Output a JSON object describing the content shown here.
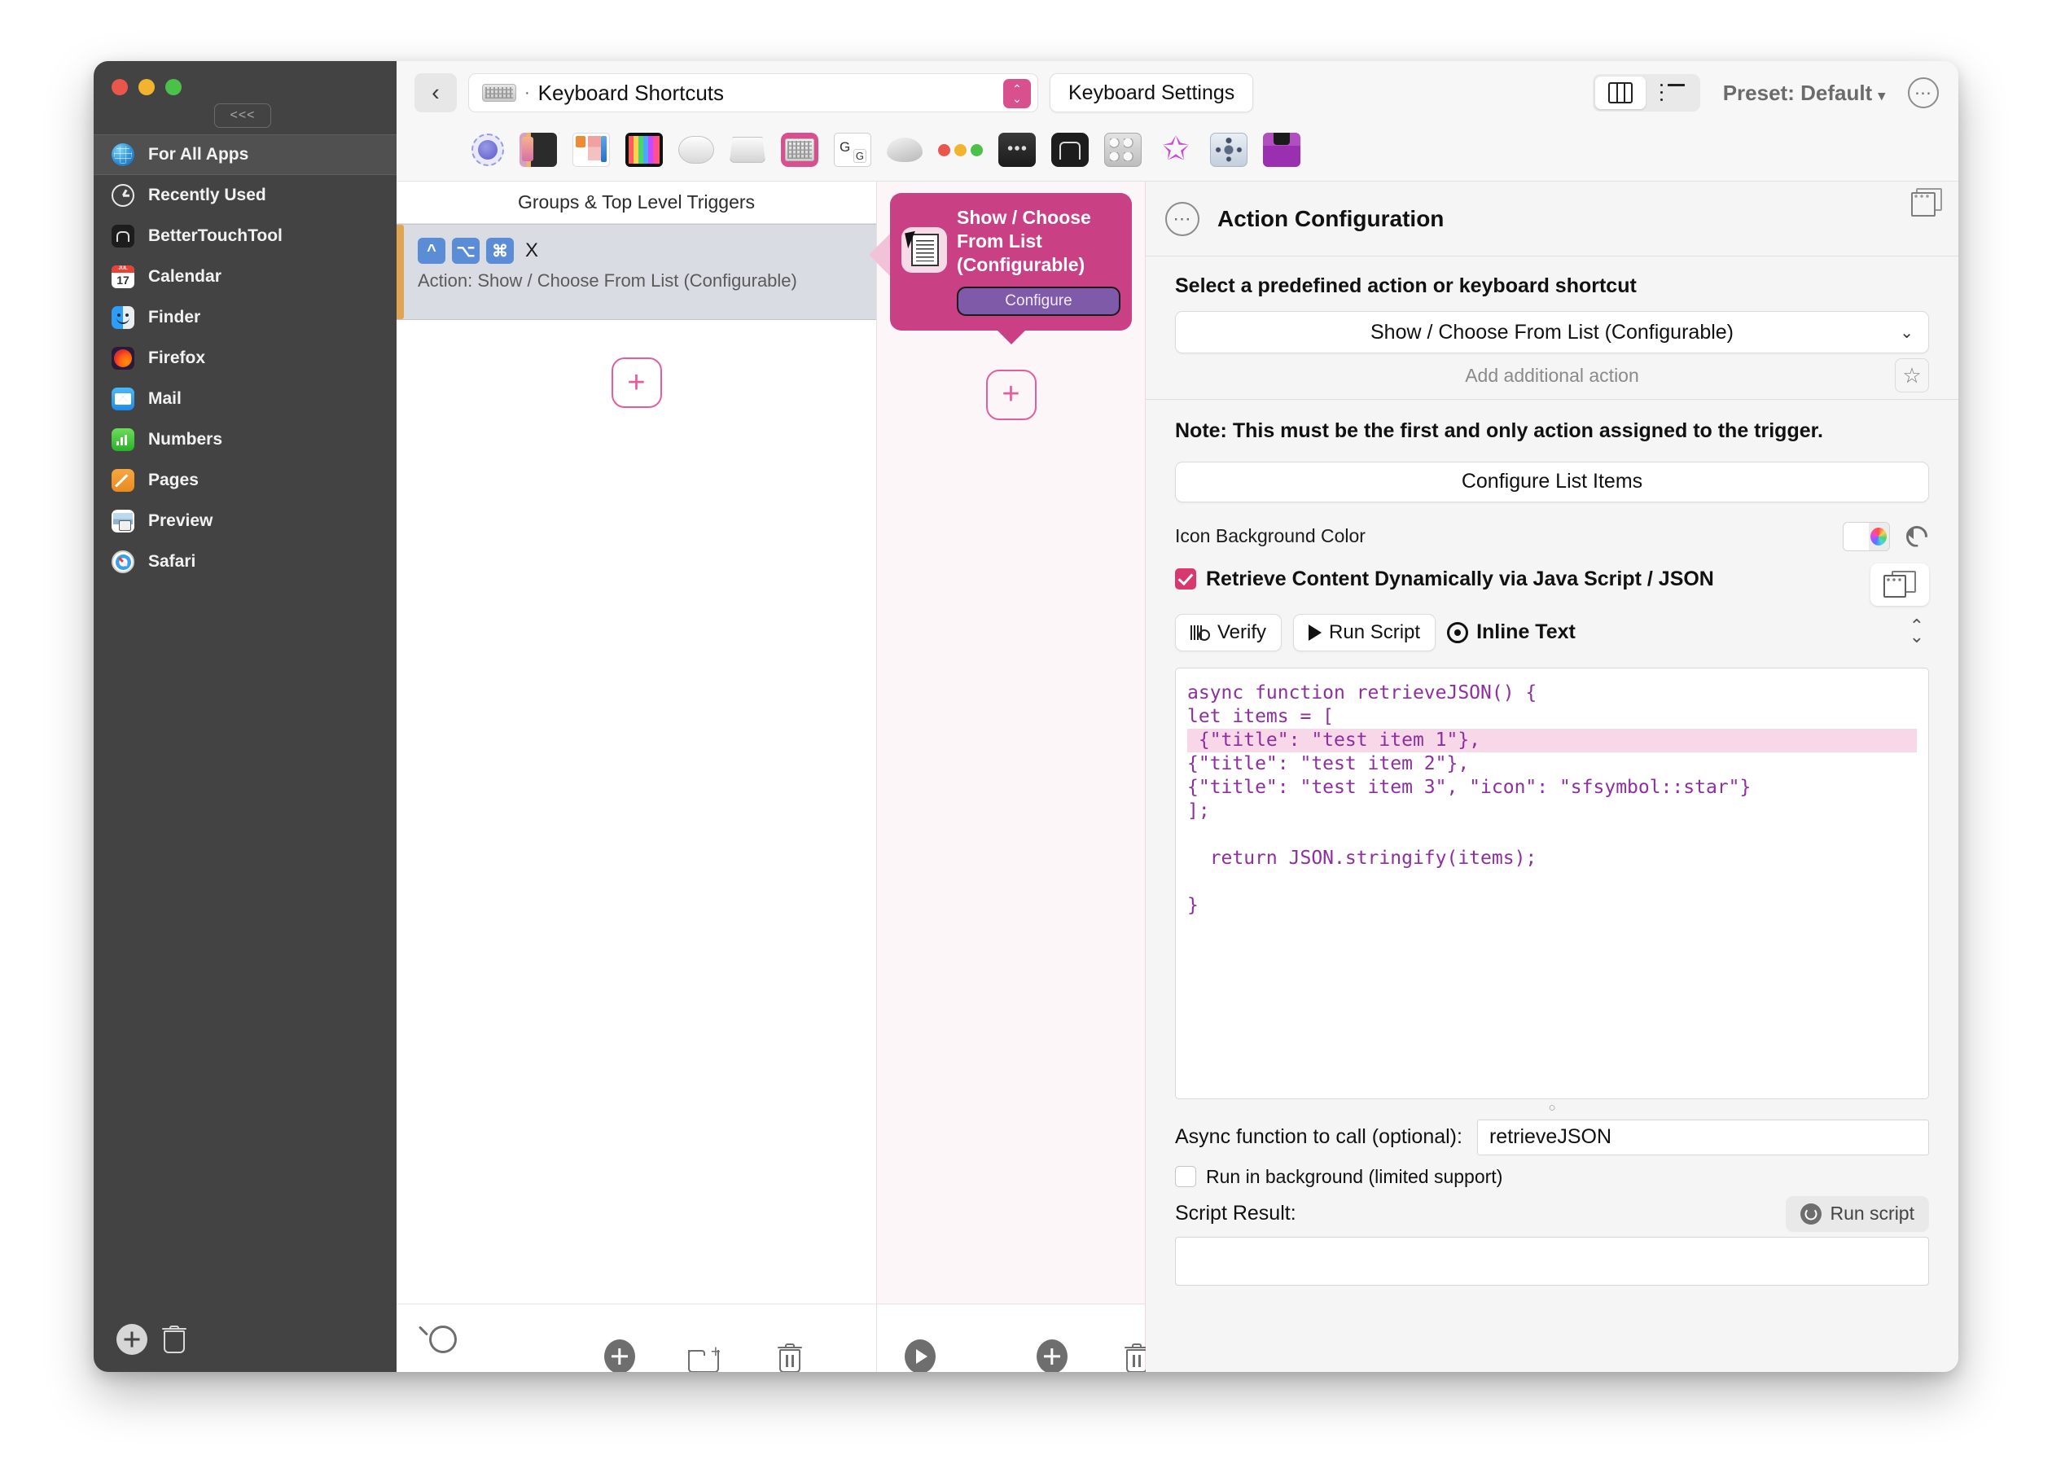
{
  "window": {
    "collapse_label": "<<<"
  },
  "sidebar": {
    "items": [
      {
        "label": "For All Apps",
        "icon": "globe-icon",
        "selected": true
      },
      {
        "label": "Recently Used",
        "icon": "clock-icon",
        "selected": false
      },
      {
        "label": "BetterTouchTool",
        "icon": "bettertouchtool-icon",
        "selected": false
      },
      {
        "label": "Calendar",
        "icon": "calendar-icon",
        "selected": false
      },
      {
        "label": "Finder",
        "icon": "finder-icon",
        "selected": false
      },
      {
        "label": "Firefox",
        "icon": "firefox-icon",
        "selected": false
      },
      {
        "label": "Mail",
        "icon": "mail-icon",
        "selected": false
      },
      {
        "label": "Numbers",
        "icon": "numbers-icon",
        "selected": false
      },
      {
        "label": "Pages",
        "icon": "pages-icon",
        "selected": false
      },
      {
        "label": "Preview",
        "icon": "preview-icon",
        "selected": false
      },
      {
        "label": "Safari",
        "icon": "safari-icon",
        "selected": false
      }
    ],
    "add_icon": "plus-icon",
    "delete_icon": "trash-icon"
  },
  "toolbar": {
    "back_icon": "chevron-left-icon",
    "path_separator": "·",
    "path_label": "Keyboard Shortcuts",
    "path_icon": "keyboard-icon",
    "stepper_icon": "up-down-stepper-icon",
    "settings_button": "Keyboard Settings",
    "view_columns_icon": "columns-view-icon",
    "view_list_icon": "list-view-icon",
    "preset_label": "Preset: Default",
    "preset_caret": "▾",
    "more_icon": "ellipsis-icon",
    "trigger_type_icons": [
      "magic-gesture-icon",
      "touch-bar-icon",
      "stream-deck-icon",
      "grid-icon",
      "magic-mouse-icon",
      "trackpad-icon",
      "keyboard-icon",
      "generic-keys-icon",
      "normal-mouse-icon",
      "traffic-lights-icon",
      "remote-icon",
      "bettertouchtool-icon",
      "knob-icon",
      "star-icon",
      "siri-remote-icon",
      "other-device-icon"
    ]
  },
  "triggers_column": {
    "header": "Groups & Top Level Triggers",
    "rows": [
      {
        "keys": [
          "^",
          "⌥",
          "⌘"
        ],
        "letter": "X",
        "subtitle": "Action: Show / Choose From List (Configurable)"
      }
    ],
    "add_button": "+",
    "bottom_icons": [
      "search-icon",
      "add-icon",
      "new-group-folder-icon",
      "delete-icon"
    ]
  },
  "actions_column": {
    "card": {
      "title": "Show / Choose From List (Configurable)",
      "configure_button": "Configure",
      "icon": "choose-from-list-icon",
      "color": "#c94085"
    },
    "add_button": "+",
    "bottom_icons": [
      "run-icon",
      "add-icon",
      "delete-icon"
    ]
  },
  "config": {
    "header_title": "Action Configuration",
    "header_icon": "ellipsis-circle-icon",
    "window_icon": "detach-window-icon",
    "select_label": "Select a predefined action or keyboard shortcut",
    "selected_action": "Show / Choose From List (Configurable)",
    "select_chevron": "⌄",
    "add_additional_action": "Add additional action",
    "favorite_icon": "star-outline-icon",
    "note": "Note: This must be the first and only action assigned to the trigger.",
    "configure_list_items_button": "Configure List Items",
    "icon_background_color_label": "Icon Background Color",
    "color_well_icon": "color-picker-icon",
    "reset_icon": "reset-icon",
    "retrieve_checkbox": {
      "label": "Retrieve Content Dynamically via Java Script / JSON",
      "checked": true
    },
    "script_toolbar": {
      "verify_button": "Verify",
      "verify_icon": "waveform-magnifier-icon",
      "run_script_button": "Run Script",
      "run_icon": "play-icon",
      "inline_text_label": "Inline Text",
      "inline_text_icon": "gear-icon",
      "sort_icon": "up-down-chevrons-icon",
      "detach_icon": "detach-window-icon"
    },
    "code_lines": [
      {
        "text": "async function retrieveJSON() {",
        "highlight": false
      },
      {
        "text": "let items = [",
        "highlight": false
      },
      {
        "text": " {\"title\": \"test item 1\"},",
        "highlight": true
      },
      {
        "text": "{\"title\": \"test item 2\"},",
        "highlight": false
      },
      {
        "text": "{\"title\": \"test item 3\", \"icon\": \"sfsymbol::star\"}",
        "highlight": false
      },
      {
        "text": "];",
        "highlight": false
      },
      {
        "text": "",
        "highlight": false
      },
      {
        "text": "  return JSON.stringify(items);",
        "highlight": false
      },
      {
        "text": "",
        "highlight": false
      },
      {
        "text": "}",
        "highlight": false
      }
    ],
    "resize_grip": "○",
    "async_label": "Async function to call (optional):",
    "async_value": "retrieveJSON",
    "background_checkbox": {
      "label": "Run in background (limited support)",
      "checked": false
    },
    "script_result_label": "Script Result:",
    "run_script_small_button": "Run script",
    "run_script_small_icon": "run-circle-icon"
  }
}
